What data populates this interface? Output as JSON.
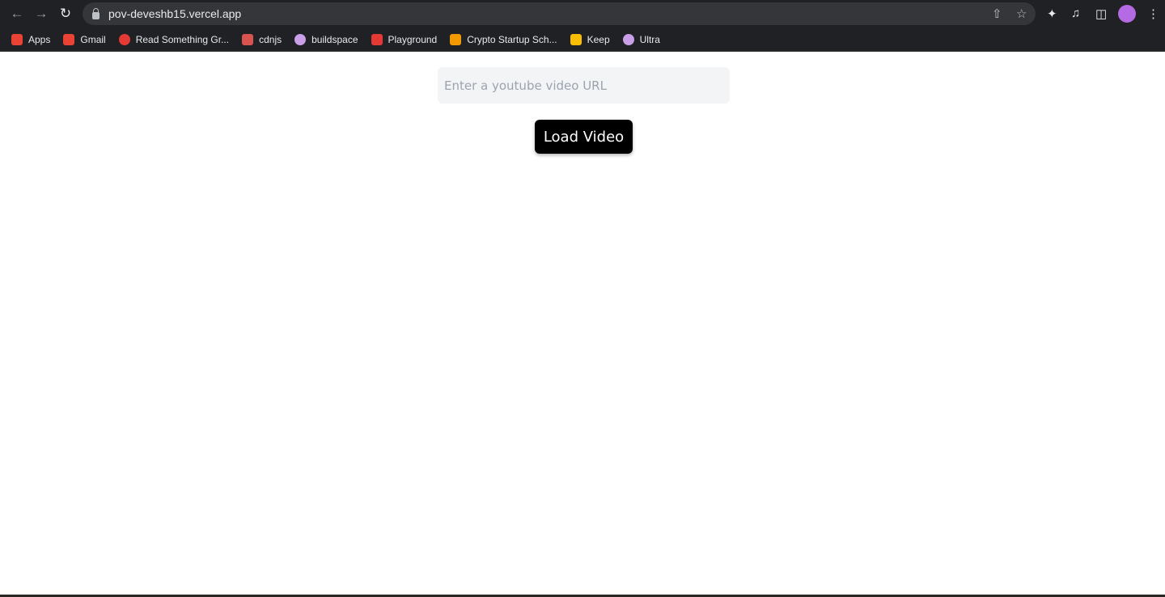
{
  "browser": {
    "url": "pov-deveshb15.vercel.app",
    "bookmarks": [
      {
        "label": "Apps",
        "icon": "apps-grid-icon",
        "color": "#ea4335"
      },
      {
        "label": "Gmail",
        "icon": "gmail-icon",
        "color": "#ea4335"
      },
      {
        "label": "Read Something Gr...",
        "icon": "read-something-icon",
        "color": "#e53935"
      },
      {
        "label": "cdnjs",
        "icon": "code-icon",
        "color": "#d9534f"
      },
      {
        "label": "buildspace",
        "icon": "unicorn-icon",
        "color": "#c9a0e8"
      },
      {
        "label": "Playground",
        "icon": "playground-icon",
        "color": "#e53935"
      },
      {
        "label": "Crypto Startup Sch...",
        "icon": "crypto-startup-icon",
        "color": "#f29900"
      },
      {
        "label": "Keep",
        "icon": "keep-icon",
        "color": "#fbbc04"
      },
      {
        "label": "Ultra",
        "icon": "ultra-icon",
        "color": "#c9a0e8"
      }
    ]
  },
  "page": {
    "url_input": {
      "placeholder": "Enter a youtube video URL",
      "value": ""
    },
    "load_button": "Load Video"
  }
}
